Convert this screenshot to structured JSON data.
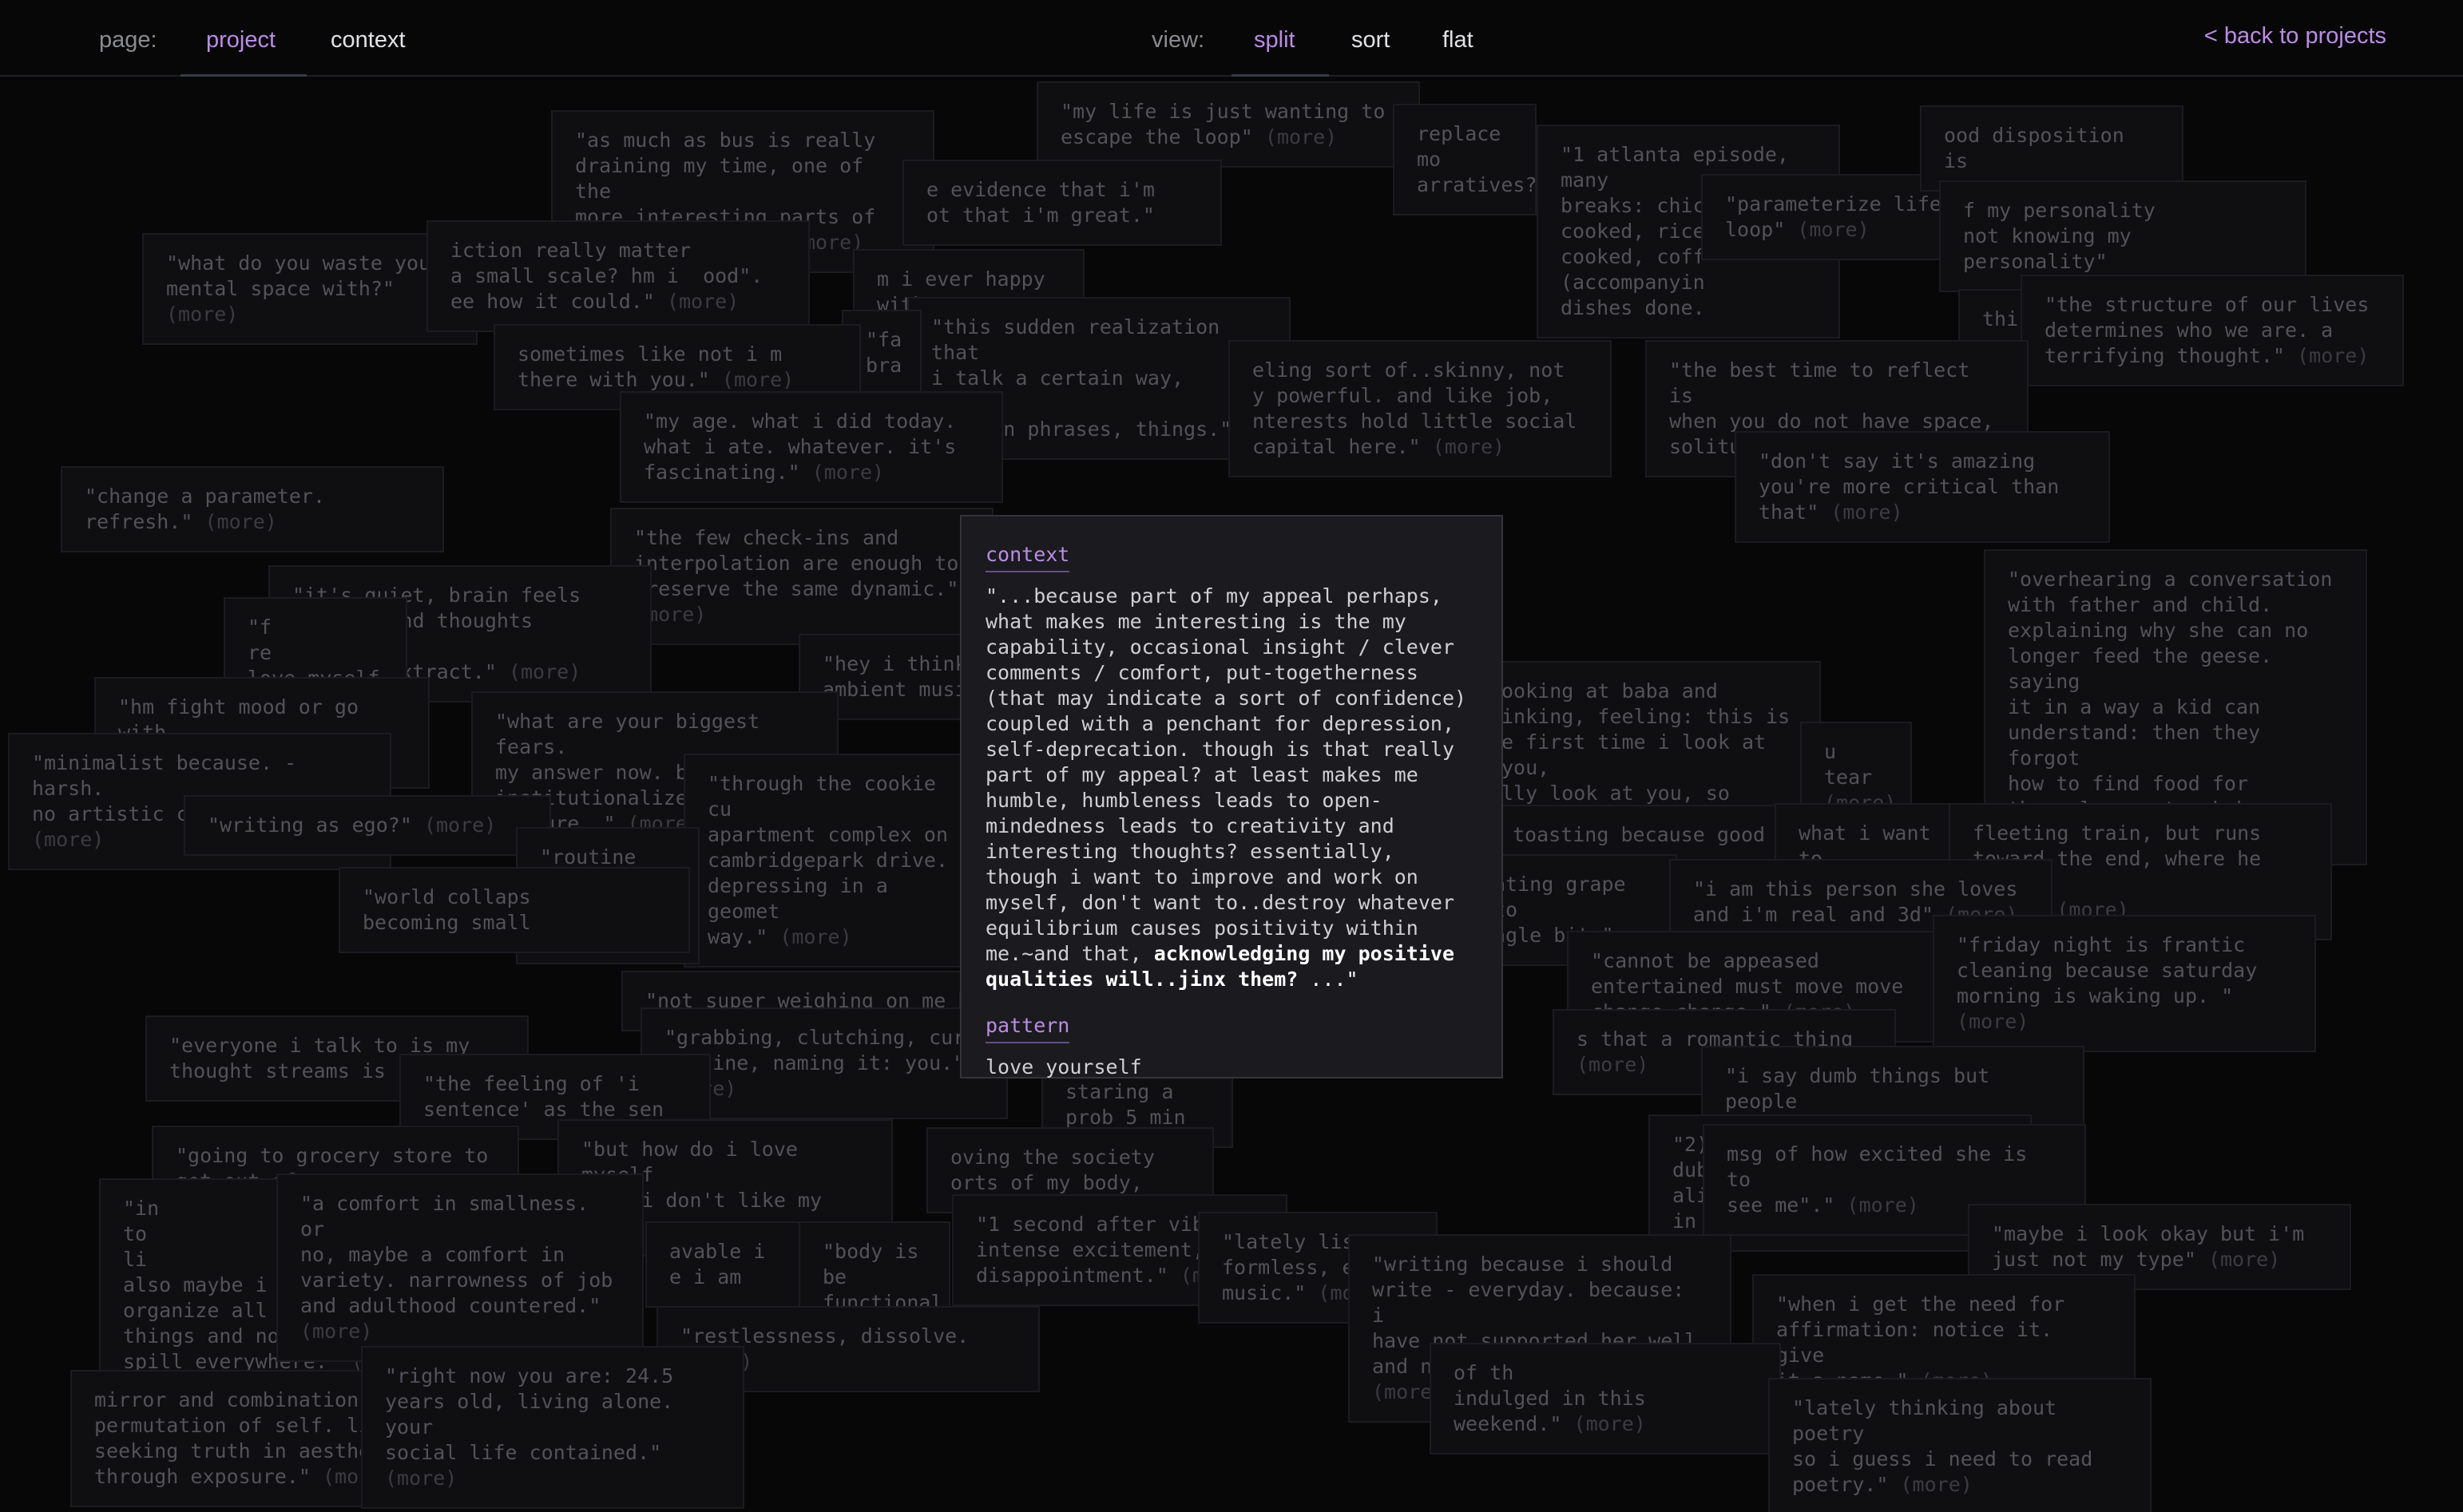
{
  "header": {
    "page_label": "page:",
    "page_tabs": [
      "project",
      "context"
    ],
    "view_label": "view:",
    "view_tabs": [
      "split",
      "sort",
      "flat"
    ],
    "back_link": "< back to projects"
  },
  "more_label": "(more)",
  "cards": [
    {
      "text": "\"as much as bus is really\ndraining my time, one of the\nmore interesting parts of\nday. objectively\"",
      "more": true
    },
    {
      "text": "\"my life is just wanting to\nescape the loop\"",
      "more": true
    },
    {
      "text": "replace mo\narratives?\"",
      "more": false
    },
    {
      "text": "\"1 atlanta episode, many\nbreaks: chicken cooked, rice\ncooked, coff\n(accompanyin\ndishes done.",
      "more": false
    },
    {
      "text": "\"parameterize life, loop\"",
      "more": true
    },
    {
      "text": "ood disposition\nis",
      "more": false
    },
    {
      "text": "f my personality\nnot knowing my\npersonality\"",
      "more": false
    },
    {
      "text": "e evidence that i'm\not that i'm great.\"",
      "more": false
    },
    {
      "text": "\"what do you waste your\nmental space with?\"",
      "more": true
    },
    {
      "text": "iction really matter\na small scale? hm i  ood\".\nee how it could.\"",
      "more": true
    },
    {
      "text": "m i ever happy with\nning\"",
      "more": false
    },
    {
      "text": "\"this sudden realization that\ni talk a certain way, repeat\ncertain phrases, things.\"",
      "more": false
    },
    {
      "text": "\"fa\nbra",
      "more": false
    },
    {
      "text": "thi\npow",
      "more": false
    },
    {
      "text": "\"the structure of our lives\ndetermines who we are. a\nterrifying thought.\"",
      "more": true
    },
    {
      "text": "sometimes like not i m\nthere with you.\"",
      "more": true
    },
    {
      "text": "eling sort of..skinny, not\ny powerful. and like job,\nnterests hold little social\ncapital here.\"",
      "more": true
    },
    {
      "text": "\"the best time to reflect is\nwhen you do not have space,\nsolitude?\"",
      "more": true
    },
    {
      "text": "\"my age. what i did today.\nwhat i ate. whatever. it's\nfascinating.\"",
      "more": true
    },
    {
      "text": "\"don't say it's amazing\nyou're more critical than\nthat\"",
      "more": true
    },
    {
      "text": "\"change a parameter.\nrefresh.\"",
      "more": true
    },
    {
      "text": "\"the few check-ins and\ninterpolation are enough to\npreserve the same dynamic.\"",
      "more": true
    },
    {
      "text": "\"overhearing a conversation\nwith father and child.\nexplaining why she can no\nlonger feed the geese. saying\nit in a way a kid can\nunderstand: then they forgot\nhow to find food for\nthemselves. struck by\neloquence.\"",
      "more": true
    },
    {
      "text": "\"it's quiet, brain feels\nvacant, and thoughts are..too\neasy to extract.\"",
      "more": true
    },
    {
      "text": "\"f\nre\nlove myself .\"",
      "more": true
    },
    {
      "text": "\"hey i think\nambient music",
      "more": false
    },
    {
      "text": "\"hm fight mood or go with\nmood.\"",
      "more": true
    },
    {
      "text": "\"what are your biggest fears.\nmy answer now. becoming\ninstitutionalized\nculture. \"",
      "more": true
    },
    {
      "text": "\"minimalist because. - harsh.\nno artistic capabilities\"",
      "more": true
    },
    {
      "text": "\"through the cookie cu\napartment complex on\ncambridgepark drive.\ndepressing in a geomet\nway.\"",
      "more": true
    },
    {
      "text": "ooking at baba and\ninking, feeling: this is\ne first time i look at you,\nlly look at you, so\nply.\"",
      "more": true
    },
    {
      "text": "u tear",
      "more": true
    },
    {
      "text": "\"writing as ego?\"",
      "more": true
    },
    {
      "text": "\"routine make\nhappiness is",
      "more": true
    },
    {
      "text": "toasting because good",
      "more": false
    },
    {
      "text": "what i want to\nlove. a",
      "more": false
    },
    {
      "text": "fleeting train, but runs\ntoward the end, where he can\nseat.\"",
      "more": true
    },
    {
      "text": "\"world collaps\nbecoming small",
      "more": false
    },
    {
      "text": "ating grape to\nngle bite\"",
      "more": false
    },
    {
      "text": "\"i am this person she loves\nand i'm real and 3d\"",
      "more": true
    },
    {
      "text": "\"not super weighing on me b",
      "more": false
    },
    {
      "text": "\"cannot be appeased\nentertained must move move\nchange change \"",
      "more": true
    },
    {
      "text": "\"friday night is frantic\ncleaning because saturday\nmorning is waking up. \"",
      "more": true
    },
    {
      "text": "\"everyone i talk to is my\nthought streams is s",
      "more": true
    },
    {
      "text": "\"grabbing, clutching, curr\nroutine, naming it: you.\"",
      "more": true
    },
    {
      "text": "\"the feeling of 'i\nsentence' as the sen",
      "more": false
    },
    {
      "text": "staring a\nprob 5 min",
      "more": false
    },
    {
      "text": "s that a romantic thing",
      "more": true
    },
    {
      "text": "\"i say dumb things but people\nsay dumb things\"",
      "more": true
    },
    {
      "text": "\"going to grocery store to\nget out of\nto escape\nand thinki\ntoo easy\"",
      "more": false
    },
    {
      "text": "\"but how do i love myself\nwhen i don't like my face\"",
      "more": false
    },
    {
      "text": "oving the society\norts of my body,",
      "more": false
    },
    {
      "text": "\"2)\ndub\nalive\nin some ways nice looking\"",
      "more": false
    },
    {
      "text": "msg of how excited she is to\nsee me\".\"",
      "more": true
    },
    {
      "text": "\"in\nto\nli\nalso maybe i s\norganize all m\nthings and not continue to\nspill everywhere.\"",
      "more": true
    },
    {
      "text": "\"a comfort in smallness. or\nno, maybe a comfort in\nvariety. narrowness of job\nand adulthood countered.\"",
      "more": true
    },
    {
      "text": "\"1 second after vibr\nintense excitement,\ndisappointment.\"",
      "more": true
    },
    {
      "text": "\"lately lis\nformless, e\nmusic.\"",
      "more": true
    },
    {
      "text": "\"maybe i look okay but i'm\njust not my type\"",
      "more": true
    },
    {
      "text": "avable i\ne i am",
      "more": false
    },
    {
      "text": "\"body is be\nfunctional",
      "more": false
    },
    {
      "text": "\"writing because i should\nwrite - everyday. because: i\nhave not supported her well\nand need to do better.\"",
      "more": true
    },
    {
      "text": "\"when i get the need for\naffirmation: notice it. give\nit a name.\"",
      "more": true
    },
    {
      "text": "\"restlessness, dissolve.",
      "more": true
    },
    {
      "text": "mirror and combination\npermutation of self. li\nseeking truth in aesthe\nthrough exposure.\"",
      "more": true
    },
    {
      "text": "\"right now you are: 24.5\nyears old, living alone. your\nsocial life contained.\"",
      "more": true
    },
    {
      "text": "of th\nindulged in this weekend.\"",
      "more": true
    },
    {
      "text": "\"lately thinking about poetry\nso i guess i need to read\npoetry.\"",
      "more": true
    }
  ],
  "modal": {
    "context_heading": "context",
    "context_text": "\"...because part of my appeal perhaps, what makes me interesting is the my capability, occasional insight / clever comments / comfort, put-togetherness (that may indicate a sort of confidence) coupled with a penchant for depression, self-deprecation. though is that really part of my appeal? at least makes me humble, humbleness leads to open-mindedness leads to creativity and interesting thoughts? essentially, though i want to improve and work on myself, don't want to..destroy whatever equilibrium causes positivity within me.~and that, ",
    "context_bold": "acknowledging my positive qualities will..jinx them?",
    "context_tail": " ...\"",
    "pattern_heading": "pattern",
    "pattern_text": "love yourself"
  }
}
